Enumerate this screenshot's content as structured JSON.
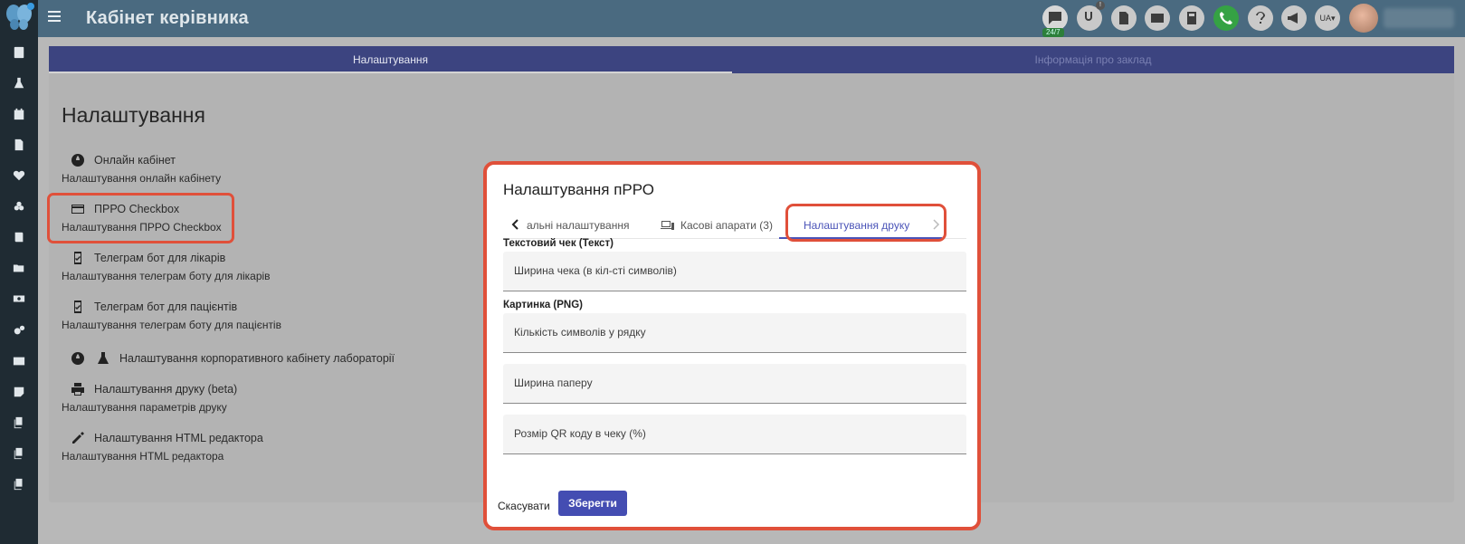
{
  "header": {
    "title": "Кабінет керівника",
    "support_badge": "24/7",
    "notification_badge": "!",
    "language": "UA"
  },
  "page_tabs": [
    {
      "label": "Налаштування",
      "active": true
    },
    {
      "label": "Інформація про заклад",
      "active": false
    }
  ],
  "settings": {
    "title": "Налаштування",
    "items": [
      {
        "label": "Онлайн кабінет",
        "sub": "Налаштування онлайн кабінету",
        "icon": "globe-icon"
      },
      {
        "label": "ПРРО Checkbox",
        "sub": "Налаштування ПРРО Checkbox",
        "icon": "credit-card-icon"
      },
      {
        "label": "Телеграм бот для лікарів",
        "sub": "Налаштування телеграм боту для лікарів",
        "icon": "phone-check-icon"
      },
      {
        "label": "Телеграм бот для пацієнтів",
        "sub": "Налаштування телеграм боту для пацієнтів",
        "icon": "phone-check-icon"
      },
      {
        "label": "Налаштування корпоративного кабінету лабораторії",
        "sub": "",
        "icon": "globe-flask-icon"
      },
      {
        "label": "Налаштування друку (beta)",
        "sub": "Налаштування параметрів друку",
        "icon": "printer-icon"
      },
      {
        "label": "Налаштування HTML редактора",
        "sub": "Налаштування HTML редактора",
        "icon": "pencil-icon"
      }
    ]
  },
  "dialog": {
    "title": "Налаштування пРРО",
    "tabs": [
      {
        "label": "альні налаштування",
        "active": false
      },
      {
        "label": "Касові апарати (3)",
        "active": false
      },
      {
        "label": "Налаштування друку",
        "active": true
      }
    ],
    "sections": {
      "text_receipt": "Текстовий чек (Текст)",
      "image_png": "Картинка (PNG)"
    },
    "fields": {
      "receipt_width": "Ширина чека (в кіл-сті символів)",
      "chars_per_line": "Кількість символів у рядку",
      "paper_width": "Ширина паперу",
      "qr_size": "Розмір QR коду в чеку (%)"
    },
    "cancel_label": "Скасувати",
    "save_label": "Зберегти"
  },
  "colors": {
    "accent": "#444db2",
    "highlight": "#e0503a",
    "sidebar": "#1f2b33",
    "topbar": "#4a6a80"
  }
}
